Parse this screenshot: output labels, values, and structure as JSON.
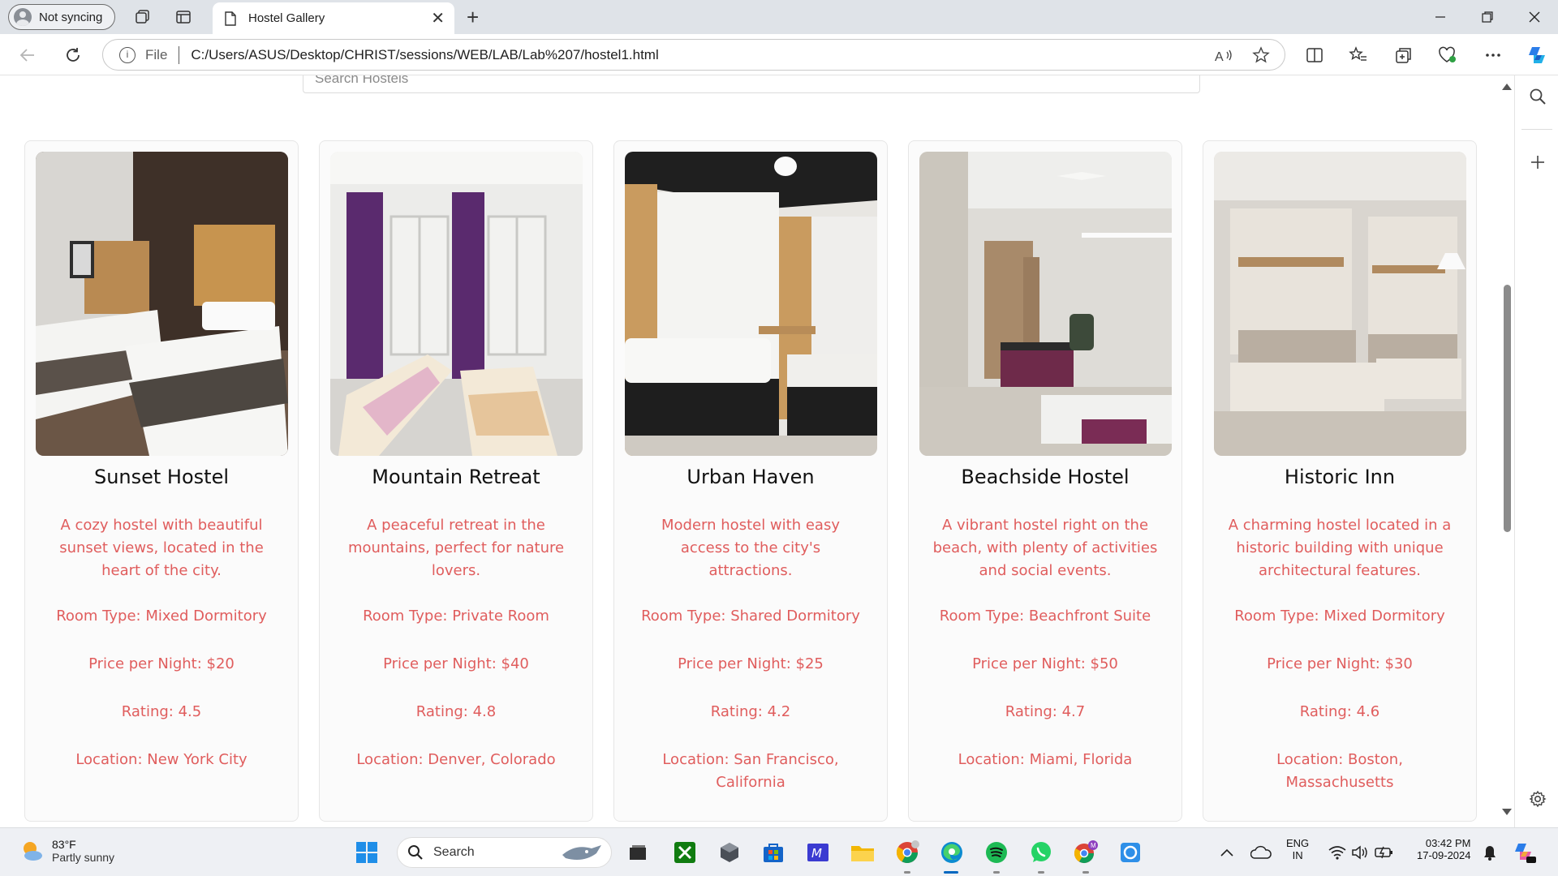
{
  "browser": {
    "profile_label": "Not syncing",
    "tab_title": "Hostel Gallery",
    "address_prefix": "File",
    "url": "C:/Users/ASUS/Desktop/CHRIST/sessions/WEB/LAB/Lab%207/hostel1.html"
  },
  "page": {
    "search_placeholder": "Search Hostels",
    "hostels": [
      {
        "name": "Sunset Hostel",
        "description": "A cozy hostel with beautiful sunset views, located in the heart of the city.",
        "room_type": "Room Type: Mixed Dormitory",
        "price": "Price per Night: $20",
        "rating": "Rating: 4.5",
        "location": "Location: New York City"
      },
      {
        "name": "Mountain Retreat",
        "description": "A peaceful retreat in the mountains, perfect for nature lovers.",
        "room_type": "Room Type: Private Room",
        "price": "Price per Night: $40",
        "rating": "Rating: 4.8",
        "location": "Location: Denver, Colorado"
      },
      {
        "name": "Urban Haven",
        "description": "Modern hostel with easy access to the city's attractions.",
        "room_type": "Room Type: Shared Dormitory",
        "price": "Price per Night: $25",
        "rating": "Rating: 4.2",
        "location": "Location: San Francisco, California"
      },
      {
        "name": "Beachside Hostel",
        "description": "A vibrant hostel right on the beach, with plenty of activities and social events.",
        "room_type": "Room Type: Beachfront Suite",
        "price": "Price per Night: $50",
        "rating": "Rating: 4.7",
        "location": "Location: Miami, Florida"
      },
      {
        "name": "Historic Inn",
        "description": "A charming hostel located in a historic building with unique architectural features.",
        "room_type": "Room Type: Mixed Dormitory",
        "price": "Price per Night: $30",
        "rating": "Rating: 4.6",
        "location": "Location: Boston, Massachusetts"
      }
    ]
  },
  "taskbar": {
    "weather_temp": "83°F",
    "weather_condition": "Partly sunny",
    "search_label": "Search",
    "language_line1": "ENG",
    "language_line2": "IN",
    "time": "03:42 PM",
    "date": "17-09-2024"
  },
  "colors": {
    "card_text": "#e05d5d",
    "accent": "#0078d4"
  }
}
